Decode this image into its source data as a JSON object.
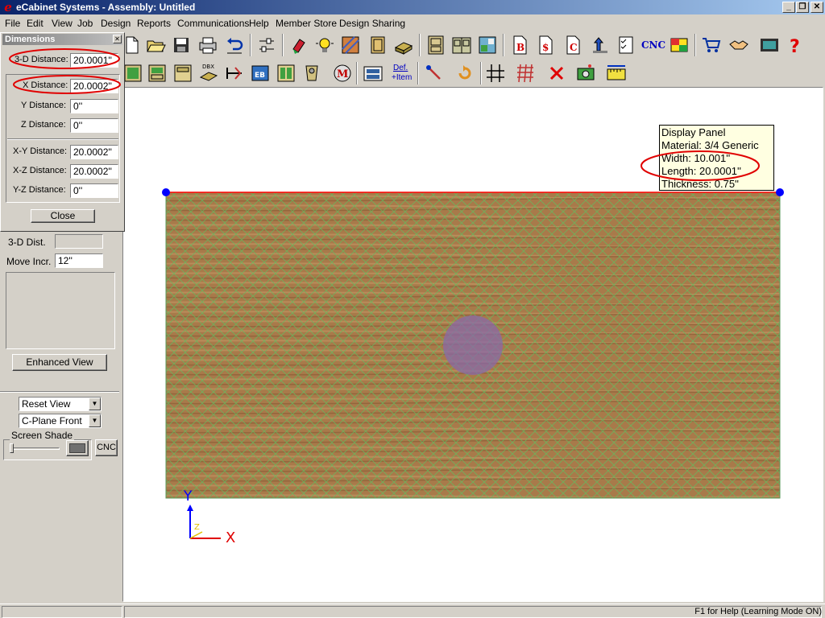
{
  "window": {
    "title": "eCabinet Systems - Assembly: Untitled"
  },
  "menu": [
    "File",
    "Edit",
    "View",
    "Job",
    "Design",
    "Reports",
    "Communications",
    "Help",
    "Member Store",
    "Design Sharing"
  ],
  "toolbar": {
    "cnc_label": "CNC",
    "dbx_label": "DBX",
    "def_label_line1": "Def.",
    "def_label_line2": "+Item"
  },
  "dimensions_dialog": {
    "title": "Dimensions",
    "fields": [
      {
        "label": "3-D Distance:",
        "value": "20.0001''"
      },
      {
        "label": "X Distance:",
        "value": "20.0002''"
      },
      {
        "label": "Y Distance:",
        "value": "0''"
      },
      {
        "label": "Z Distance:",
        "value": "0''"
      },
      {
        "label": "X-Y Distance:",
        "value": "20.0002''"
      },
      {
        "label": "X-Z Distance:",
        "value": "20.0002''"
      },
      {
        "label": "Y-Z Distance:",
        "value": "0''"
      }
    ],
    "close_label": "Close"
  },
  "left_panel": {
    "dist_label": "3-D Dist.",
    "dist_value": "",
    "move_label": "Move Incr.",
    "move_value": "12''",
    "enhanced_view_label": "Enhanced View",
    "view_select": "Reset View",
    "cplane_select": "C-Plane Front",
    "screen_shade_label": "Screen Shade",
    "cnc_button_label": "CNC"
  },
  "tooltip": {
    "lines": [
      "Display Panel",
      "Material: 3/4 Generic",
      "Width: 10.001''",
      "Length: 20.0001''",
      "Thickness: 0.75''"
    ]
  },
  "axes": {
    "y_label": "Y",
    "x_label": "X",
    "z_label": "Z"
  },
  "status": {
    "help_text": "F1 for Help (Learning Mode ON)"
  },
  "colors": {
    "highlight_ellipse": "#e00000",
    "panel_wood": "#a87a4a",
    "grid_lines": "#5fc05f",
    "selection_line": "#ff0000",
    "handle": "#0000ff",
    "hole": "#8a6aa8"
  }
}
